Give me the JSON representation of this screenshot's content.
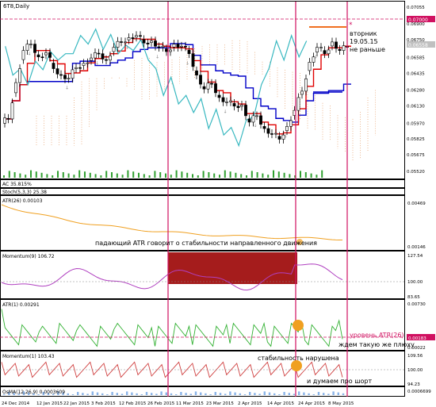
{
  "window": {
    "title": "6T8,Daily"
  },
  "colors": {
    "candle_up": "#ffffff",
    "candle_down": "#000000",
    "tenkan": "#e00000",
    "kijun": "#0000c8",
    "chikou": "#38b8c0",
    "cloud": "#e8a878",
    "atr26": "#f0a020",
    "momentum": "#b040c0",
    "atr1": "#30b030",
    "momentum1": "#d04040",
    "osma": "#8ab4e8",
    "vline": "#d01060",
    "block": "#a01010",
    "marker": "#f0a020",
    "hline": "#d01060"
  },
  "chart_data": [
    {
      "type": "line",
      "title": "6T8,Daily",
      "pane": "price",
      "y_ticks": [
        "0.07055",
        "0.06900",
        "0.06750",
        "0.06585",
        "0.06435",
        "0.06280",
        "0.06130",
        "0.05970",
        "0.05825",
        "0.05675",
        "0.05520"
      ],
      "current_value": "0.06558",
      "highlight_value": "0.07000",
      "series": [
        {
          "name": "close",
          "values": [
            0.0601,
            0.0635,
            0.0665,
            0.0671,
            0.0659,
            0.0663,
            0.0648,
            0.0642,
            0.0639,
            0.0649,
            0.0653,
            0.0658,
            0.0662,
            0.0656,
            0.0668,
            0.0673,
            0.0677,
            0.0679,
            0.0672,
            0.0674,
            0.0668,
            0.0664,
            0.0671,
            0.0669,
            0.0662,
            0.0642,
            0.0629,
            0.0634,
            0.0621,
            0.0617,
            0.0613,
            0.0614,
            0.0598,
            0.0604,
            0.0592,
            0.0587,
            0.0582,
            0.0594,
            0.0609,
            0.0627,
            0.0654,
            0.0668,
            0.0662,
            0.0673,
            0.0665,
            0.0668
          ]
        }
      ]
    },
    {
      "type": "line",
      "pane": "indicator",
      "title": "ATR(26) 0.00103",
      "y_ticks": [
        "0.00469",
        "0.00146"
      ]
    },
    {
      "type": "line",
      "pane": "indicator",
      "title": "Momentum(9) 106.72",
      "y_ticks": [
        "127.54",
        "100.00",
        "83.65"
      ]
    },
    {
      "type": "line",
      "pane": "indicator",
      "title": "ATR(1) 0.00291",
      "y_ticks": [
        "0.00730",
        "0.00022"
      ],
      "highlight_value": "0.00183"
    },
    {
      "type": "line",
      "pane": "indicator",
      "title": "Momentum(1) 103.43",
      "y_ticks": [
        "109.56",
        "100.00",
        "94.23"
      ]
    },
    {
      "type": "bar",
      "pane": "indicator",
      "title": "OsMA(12,26,9) 0.0003609",
      "y_ticks": [
        "0.0006699"
      ]
    }
  ],
  "x_axis": {
    "labels": [
      "24 Dec 2014",
      "12 Jan 2015",
      "22 Jan 2015",
      "3 Feb 2015",
      "12 Feb 2015",
      "26 Feb 2015",
      "11 Mar 2015",
      "23 Mar 2015",
      "2 Apr 2015",
      "14 Apr 2015",
      "24 Apr 2015",
      "8 May 2015"
    ]
  },
  "sub_labels": {
    "ac": "AC 35.815%",
    "stoch": "Stoch(5,3,3) 25.38"
  },
  "annotations": {
    "date_note_1": "вторник",
    "date_note_2": "19.05.15",
    "date_note_3": "не раньше",
    "atr_note": "падающий ATR говорит о стабильности направленного движения",
    "atr1_level": "уровень ATR(26)",
    "wait_note": "ждем такую же плюху",
    "stability_broken": "стабильность нарушена",
    "short_note": "и думаем про шорт"
  }
}
